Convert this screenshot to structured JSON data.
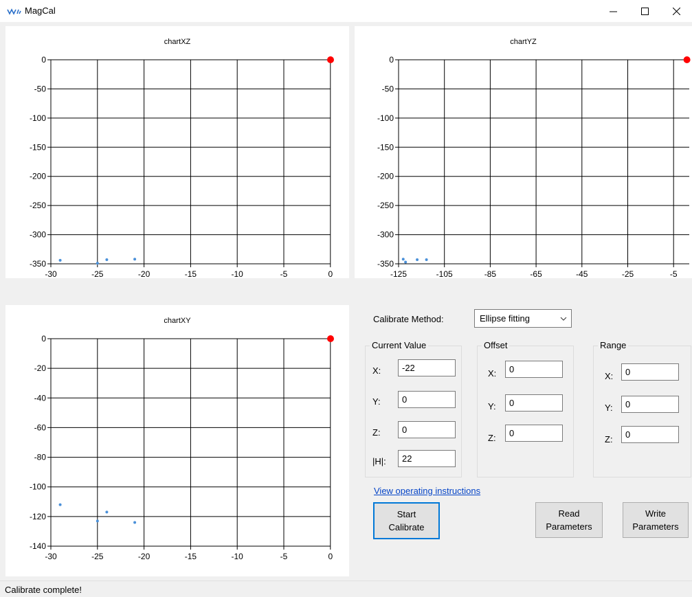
{
  "window": {
    "title": "MagCal"
  },
  "charts": {
    "xz": {
      "title": "chartXZ",
      "xticks": [
        "-30",
        "-25",
        "-20",
        "-15",
        "-10",
        "-5",
        "0"
      ],
      "yticks": [
        "0",
        "-50",
        "-100",
        "-150",
        "-200",
        "-250",
        "-300",
        "-350"
      ]
    },
    "yz": {
      "title": "chartYZ",
      "xticks": [
        "-125",
        "-105",
        "-85",
        "-65",
        "-45",
        "-25",
        "-5"
      ],
      "yticks": [
        "0",
        "-50",
        "-100",
        "-150",
        "-200",
        "-250",
        "-300",
        "-350"
      ]
    },
    "xy": {
      "title": "chartXY",
      "xticks": [
        "-30",
        "-25",
        "-20",
        "-15",
        "-10",
        "-5",
        "0"
      ],
      "yticks": [
        "0",
        "-20",
        "-40",
        "-60",
        "-80",
        "-100",
        "-120",
        "-140"
      ]
    }
  },
  "chart_data": [
    {
      "type": "scatter",
      "title": "chartXZ",
      "xlim": [
        -30,
        0
      ],
      "ylim": [
        -350,
        0
      ],
      "grid": true,
      "series": [
        {
          "points": [
            [
              -29,
              -344
            ],
            [
              -25,
              -349
            ],
            [
              -24,
              -343
            ],
            [
              -21,
              -342
            ]
          ],
          "color": "#4a90d9"
        },
        {
          "points": [
            [
              0,
              0
            ]
          ],
          "color": "#ff0000"
        }
      ]
    },
    {
      "type": "scatter",
      "title": "chartYZ",
      "xlim": [
        -125,
        0
      ],
      "ylim": [
        -350,
        0
      ],
      "grid": true,
      "series": [
        {
          "points": [
            [
              -123,
              -342
            ],
            [
              -122,
              -347
            ],
            [
              -117,
              -343
            ],
            [
              -113,
              -343
            ]
          ],
          "color": "#4a90d9"
        },
        {
          "points": [
            [
              -1,
              0
            ]
          ],
          "color": "#ff0000"
        }
      ]
    },
    {
      "type": "scatter",
      "title": "chartXY",
      "xlim": [
        -30,
        0
      ],
      "ylim": [
        -140,
        0
      ],
      "grid": true,
      "series": [
        {
          "points": [
            [
              -29,
              -112
            ],
            [
              -25,
              -123
            ],
            [
              -24,
              -117
            ],
            [
              -21,
              -124
            ]
          ],
          "color": "#4a90d9"
        },
        {
          "points": [
            [
              0,
              0
            ]
          ],
          "color": "#ff0000"
        }
      ]
    }
  ],
  "controls": {
    "method_label": "Calibrate Method:",
    "method_value": "Ellipse fitting",
    "current": {
      "legend": "Current Value",
      "x_label": "X:",
      "x_value": "-22",
      "y_label": "Y:",
      "y_value": "0",
      "z_label": "Z:",
      "z_value": "0",
      "h_label": "|H|:",
      "h_value": "22"
    },
    "offset": {
      "legend": "Offset",
      "x_label": "X:",
      "x_value": "0",
      "y_label": "Y:",
      "y_value": "0",
      "z_label": "Z:",
      "z_value": "0"
    },
    "range": {
      "legend": "Range",
      "x_label": "X:",
      "x_value": "0",
      "y_label": "Y:",
      "y_value": "0",
      "z_label": "Z:",
      "z_value": "0"
    },
    "instructions_link": "View operating instructions",
    "start_line1": "Start",
    "start_line2": "Calibrate",
    "read_line1": "Read",
    "read_line2": "Parameters",
    "write_line1": "Write",
    "write_line2": "Parameters"
  },
  "status": {
    "text": "Calibrate complete!"
  }
}
